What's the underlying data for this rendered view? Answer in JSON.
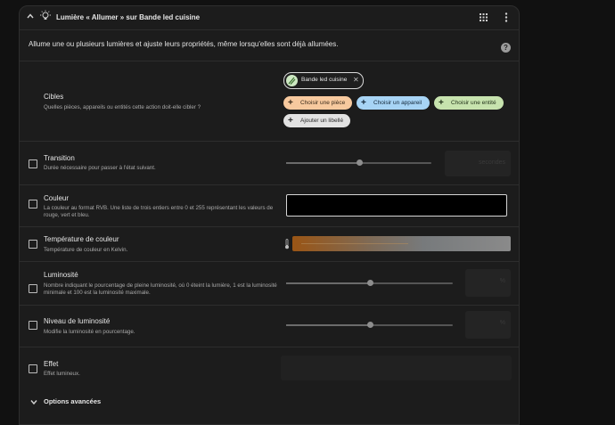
{
  "header": {
    "title": "Lumière « Allumer » sur Bande led cuisine",
    "icon": "lightbulb-icon"
  },
  "description": "Allume une ou plusieurs lumières et ajuste leurs propriétés, même lorsqu'elles sont déjà allumées.",
  "targets": {
    "label": "Cibles",
    "sublabel": "Quelles pièces, appareils ou entités cette action doit-elle cibler ?",
    "selected_chip": "Bande led cuisine",
    "choose_area": "Choisir une pièce",
    "choose_device": "Choisir un appareil",
    "choose_entity": "Choisir une entité",
    "add_label": "Ajouter un libellé",
    "colors": {
      "area": "#f7c99e",
      "device": "#a7d4f5",
      "entity": "#c7e3ae",
      "label": "#e2e2e2"
    }
  },
  "fields": {
    "transition": {
      "label": "Transition",
      "sublabel": "Durée nécessaire pour passer à l'état suivant.",
      "unit": "secondes",
      "slider_fraction": 0.5
    },
    "color": {
      "label": "Couleur",
      "sublabel": "La couleur au format RVB. Une liste de trois entiers entre 0 et 255 représentant les valeurs de rouge, vert et bleu."
    },
    "color_temp": {
      "label": "Température de couleur",
      "sublabel": "Température de couleur en Kelvin."
    },
    "brightness": {
      "label": "Luminosité",
      "sublabel": "Nombre indiquant le pourcentage de pleine luminosité, où 0 éteint la lumière, 1 est la luminosité minimale et 100 est la luminosité maximale.",
      "unit": "%",
      "slider_fraction": 0.5
    },
    "brightness_pct": {
      "label": "Niveau de luminosité",
      "sublabel": "Modifie la luminosité en pourcentage.",
      "unit": "%",
      "slider_fraction": 0.5
    },
    "effect": {
      "label": "Effet",
      "sublabel": "Effet lumineux."
    }
  },
  "advanced": {
    "label": "Options avancées"
  }
}
